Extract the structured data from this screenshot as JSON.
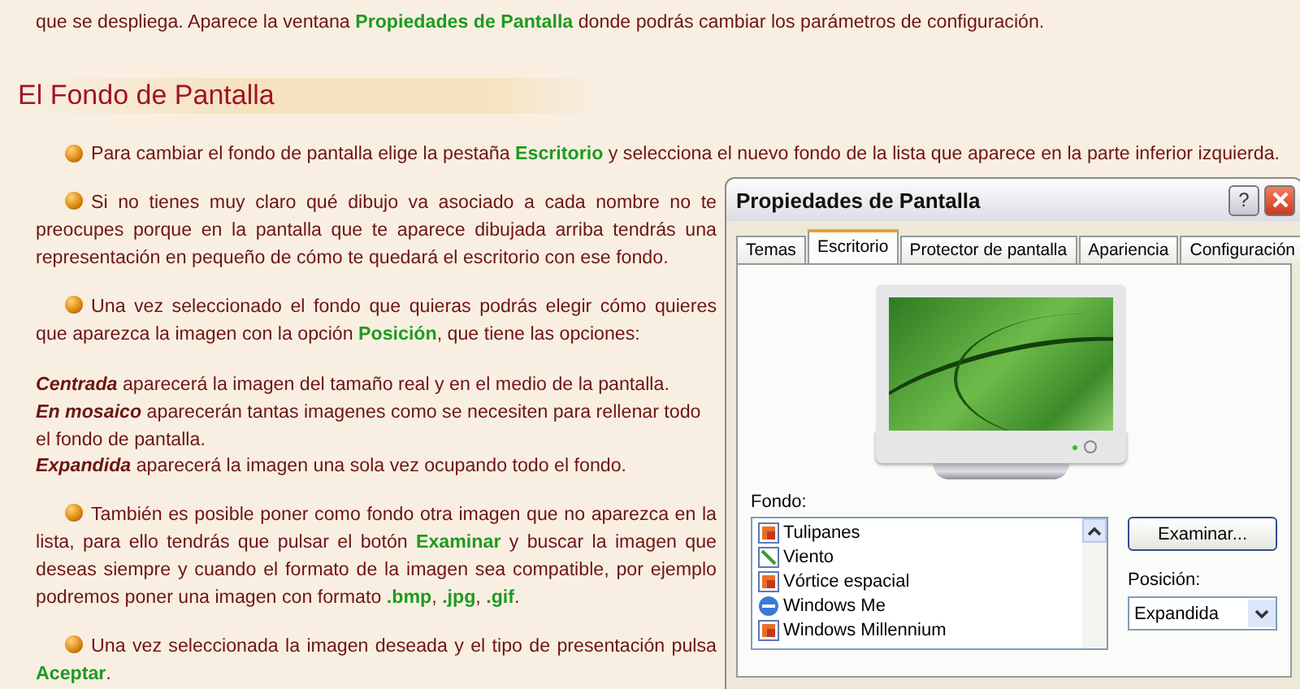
{
  "intro": "que se despliega. Aparece la ventana **Propiedades de Pantalla** donde podrás cambiar los parámetros de configuración.",
  "heading": "El Fondo de Pantalla",
  "lead": "Para cambiar el fondo de pantalla elige la pestaña **Escritorio** y selecciona el nuevo fondo de la lista que aparece en la parte inferior izquierda.",
  "paragraphs": [
    {
      "kind": "bullet",
      "text": "Si no tienes muy claro qué dibujo va asociado a cada nombre no te preocupes porque en la pantalla que te aparece dibujada arriba tendrás una representación en pequeño de cómo te quedará el escritorio con ese fondo."
    },
    {
      "kind": "bullet",
      "text": "Una vez seleccionado el fondo que quieras podrás elegir cómo quieres que aparezca la imagen con la opción **Posición**, que tiene las opciones:"
    },
    {
      "kind": "plain",
      "text": "*Centrada* aparecerá la imagen del tamaño real y en el medio de la pantalla."
    },
    {
      "kind": "plain",
      "text": "*En mosaico* aparecerán tantas imagenes como se necesiten para rellenar todo el fondo de pantalla."
    },
    {
      "kind": "plain",
      "text": "*Expandida* aparecerá la imagen una sola vez ocupando todo el fondo."
    },
    {
      "kind": "bullet",
      "text": "También es posible poner como fondo otra imagen que no aparezca en la lista, para ello tendrás que pulsar el botón **Examinar** y buscar la imagen que deseas siempre y cuando el formato de la imagen sea compatible, por ejemplo podremos poner una imagen con formato **.bmp**, **.jpg**, **.gif**."
    },
    {
      "kind": "bullet",
      "text": "Una vez seleccionada la imagen deseada y el tipo de presentación pulsa **Aceptar**."
    }
  ],
  "dialog": {
    "title": "Propiedades de Pantalla",
    "help": "?",
    "tabs": [
      {
        "label": "Temas",
        "selected": false
      },
      {
        "label": "Escritorio",
        "selected": true
      },
      {
        "label": "Protector de pantalla",
        "selected": false
      },
      {
        "label": "Apariencia",
        "selected": false
      },
      {
        "label": "Configuración",
        "selected": false
      }
    ],
    "list_label": "Fondo:",
    "backgrounds": [
      {
        "name": "Tulipanes",
        "kind": "image"
      },
      {
        "name": "Viento",
        "kind": "drawing"
      },
      {
        "name": "Vórtice espacial",
        "kind": "image"
      },
      {
        "name": "Windows Me",
        "kind": "web"
      },
      {
        "name": "Windows Millennium",
        "kind": "image"
      }
    ],
    "browse_button": "Examinar...",
    "position_label": "Posición:",
    "position_value": "Expandida"
  }
}
